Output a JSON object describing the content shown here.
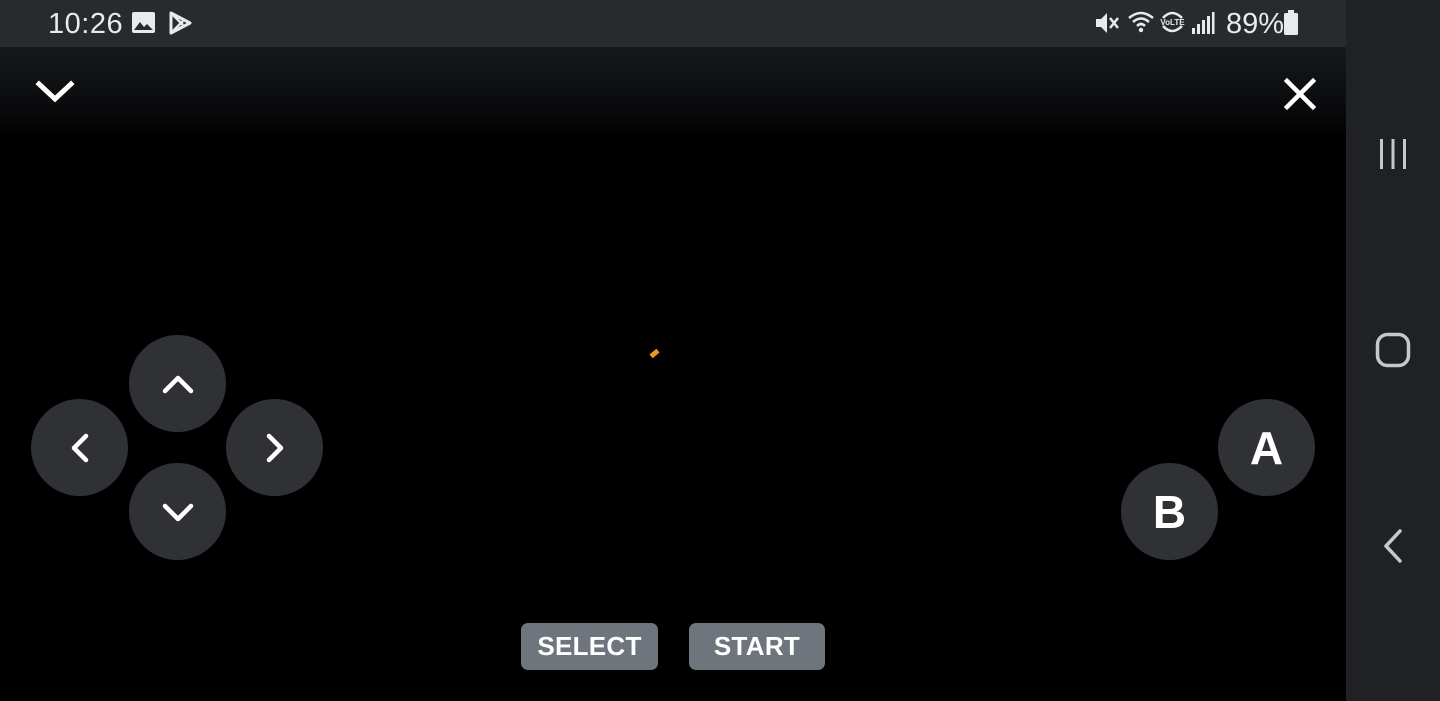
{
  "status_bar": {
    "time": "10:26",
    "battery_percent": "89%",
    "left_icons": [
      "gallery-icon",
      "play-store-icon"
    ],
    "right_icons": [
      "mute-icon",
      "wifi-icon",
      "volte-icon",
      "signal-icon",
      "battery-icon"
    ],
    "volte_text": "VoLTE"
  },
  "top_controls": {
    "collapse_icon": "chevron-down-icon",
    "close_icon": "close-icon"
  },
  "dpad": {
    "up_icon": "chevron-up-icon",
    "down_icon": "chevron-down-icon",
    "left_icon": "chevron-left-icon",
    "right_icon": "chevron-right-icon"
  },
  "action_buttons": {
    "a_label": "A",
    "b_label": "B"
  },
  "menu_buttons": {
    "select_label": "SELECT",
    "start_label": "START"
  },
  "nav_bar": {
    "recents_icon": "recents-icon",
    "home_icon": "home-icon",
    "back_icon": "back-icon"
  },
  "colors": {
    "status_bar_bg": "#282a2e",
    "nav_bar_bg": "#202124",
    "game_bg": "#000000",
    "button_bg": "#2f3135",
    "pill_bg": "#6f757c",
    "sprite": "#e79a1f"
  }
}
